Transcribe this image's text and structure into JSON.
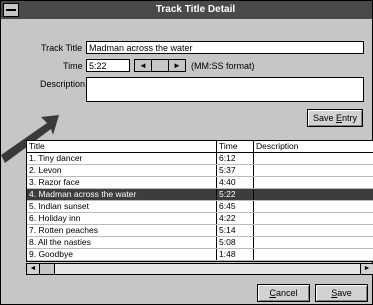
{
  "window": {
    "title": "Track Title Detail"
  },
  "form": {
    "track_title_label": "Track Title",
    "track_title_value": "Madman across the water",
    "time_label": "Time",
    "time_value": "5:22",
    "time_format_hint": "(MM:SS format)",
    "description_label": "Description",
    "description_value": "",
    "spin_left": "◄",
    "spin_right": "►",
    "save_entry_prefix": "Save ",
    "save_entry_accel": "E",
    "save_entry_suffix": "ntry"
  },
  "table": {
    "columns": [
      "Title",
      "Time",
      "Description"
    ],
    "rows": [
      {
        "title": "1. Tiny dancer",
        "time": "6:12",
        "description": ""
      },
      {
        "title": "2. Levon",
        "time": "5:37",
        "description": ""
      },
      {
        "title": "3. Razor face",
        "time": "4:40",
        "description": ""
      },
      {
        "title": "4. Madman across the water",
        "time": "5:22",
        "description": "",
        "selected": true
      },
      {
        "title": "5. Indian sunset",
        "time": "6:45",
        "description": ""
      },
      {
        "title": "6. Holiday inn",
        "time": "4:22",
        "description": ""
      },
      {
        "title": "7. Rotten peaches",
        "time": "5:14",
        "description": ""
      },
      {
        "title": "8. All the nasties",
        "time": "5:08",
        "description": ""
      },
      {
        "title": "9. Goodbye",
        "time": "1:48",
        "description": ""
      }
    ]
  },
  "scrollbar": {
    "left_arrow": "◄",
    "right_arrow": "►"
  },
  "buttons": {
    "cancel_accel": "C",
    "cancel_rest": "ancel",
    "save_accel": "S",
    "save_rest": "ave"
  },
  "colors": {
    "titlebar": "#4a4a4a",
    "selected_row": "#3d3d3d",
    "window_bg": "#c6c6c6"
  }
}
